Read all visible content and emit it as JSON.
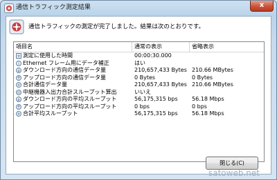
{
  "window": {
    "title": "通信トラフィック測定結果",
    "close_glyph": "x"
  },
  "message": "通信トラフィックの測定が完了しました。結果は次のとおりです。",
  "table": {
    "columns": [
      "項目名",
      "通常の表示",
      "省略表示"
    ],
    "rows": [
      {
        "name": "測定に使用した時間",
        "normal": "00:00:30.000",
        "short": ""
      },
      {
        "name": "Ethernet フレーム用にデータ補正",
        "normal": "はい",
        "short": ""
      },
      {
        "name": "ダウンロード方向の通信データ量",
        "normal": "210,657,433 Bytes",
        "short": "210.66 MBytes"
      },
      {
        "name": "アップロード方向の通信データ量",
        "normal": "0 Bytes",
        "short": "0 Bytes"
      },
      {
        "name": "合計通信データ量",
        "normal": "210,657,433 Bytes",
        "short": "210.66 MBytes"
      },
      {
        "name": "中継機器入出力合計スループット算出",
        "normal": "いいえ",
        "short": ""
      },
      {
        "name": "ダウンロード方向の平均スループット",
        "normal": "56,175,315 bps",
        "short": "56.18 Mbps"
      },
      {
        "name": "アップロード方向の平均スループット",
        "normal": "0 bps",
        "short": "0 bps"
      },
      {
        "name": "合計平均スループット",
        "normal": "56,175,315 bps",
        "short": "56.18 Mbps"
      }
    ]
  },
  "buttons": {
    "close_label": "閉じる(C)"
  },
  "watermark": "satoweb.net"
}
